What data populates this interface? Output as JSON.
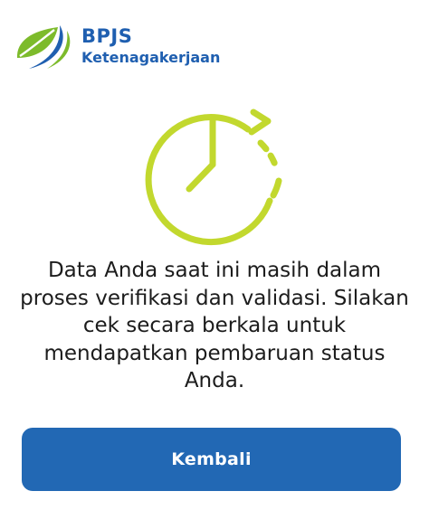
{
  "brand": {
    "logo_icon": "bpjs-logo-icon",
    "name": "BPJS",
    "subtitle": "Ketenagakerjaan",
    "color_blue": "#1f5fb0",
    "color_green": "#7dbb2b"
  },
  "illustration": {
    "icon": "clock-refresh-icon",
    "color": "#c2d82e"
  },
  "message": {
    "text": "Data Anda saat ini masih dalam proses verifikasi dan validasi. Silakan cek secara berkala untuk mendapatkan pembaruan status Anda."
  },
  "actions": {
    "back_label": "Kembali",
    "back_color": "#2268b4"
  }
}
